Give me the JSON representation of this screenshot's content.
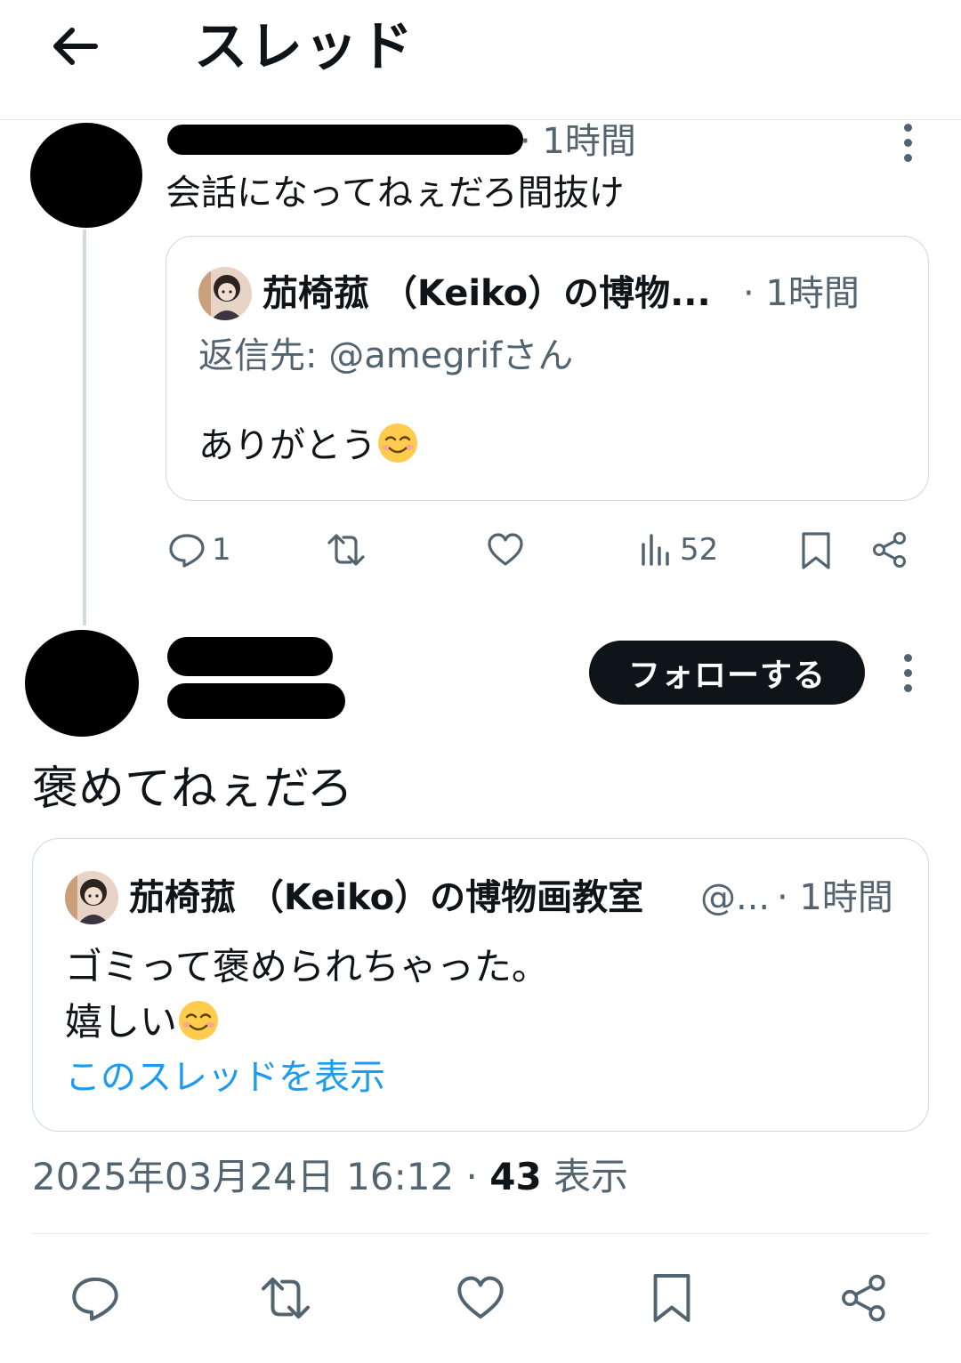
{
  "header": {
    "title": "スレッド"
  },
  "reply_tweet": {
    "time": "· 1時間",
    "text": "会話になってねぇだろ間抜け",
    "quote": {
      "name": "茄椅菰 （Keiko）の博物...",
      "time": "· 1時間",
      "reply_to": "返信先: @amegrifさん",
      "text": "ありがとう",
      "emoji": "smiling-face-icon"
    },
    "actions": {
      "reply_count": "1",
      "views_count": "52"
    }
  },
  "main_tweet": {
    "follow_label": "フォローする",
    "text": "褒めてねぇだろ",
    "quote": {
      "name": "茄椅菰 （Keiko）の博物画教室",
      "handle": "@...",
      "time": "· 1時間",
      "text_line1": "ゴミって褒められちゃった。",
      "text_line2": "嬉しい",
      "emoji": "smiling-face-icon",
      "show_thread": "このスレッドを表示"
    },
    "timestamp": "2025年03月24日 16:12 · ",
    "views_count": "43",
    "views_label": " 表示"
  },
  "colors": {
    "text": "#0f1419",
    "secondary": "#536471",
    "link": "#1d9bf0",
    "border": "#cfd9de"
  }
}
